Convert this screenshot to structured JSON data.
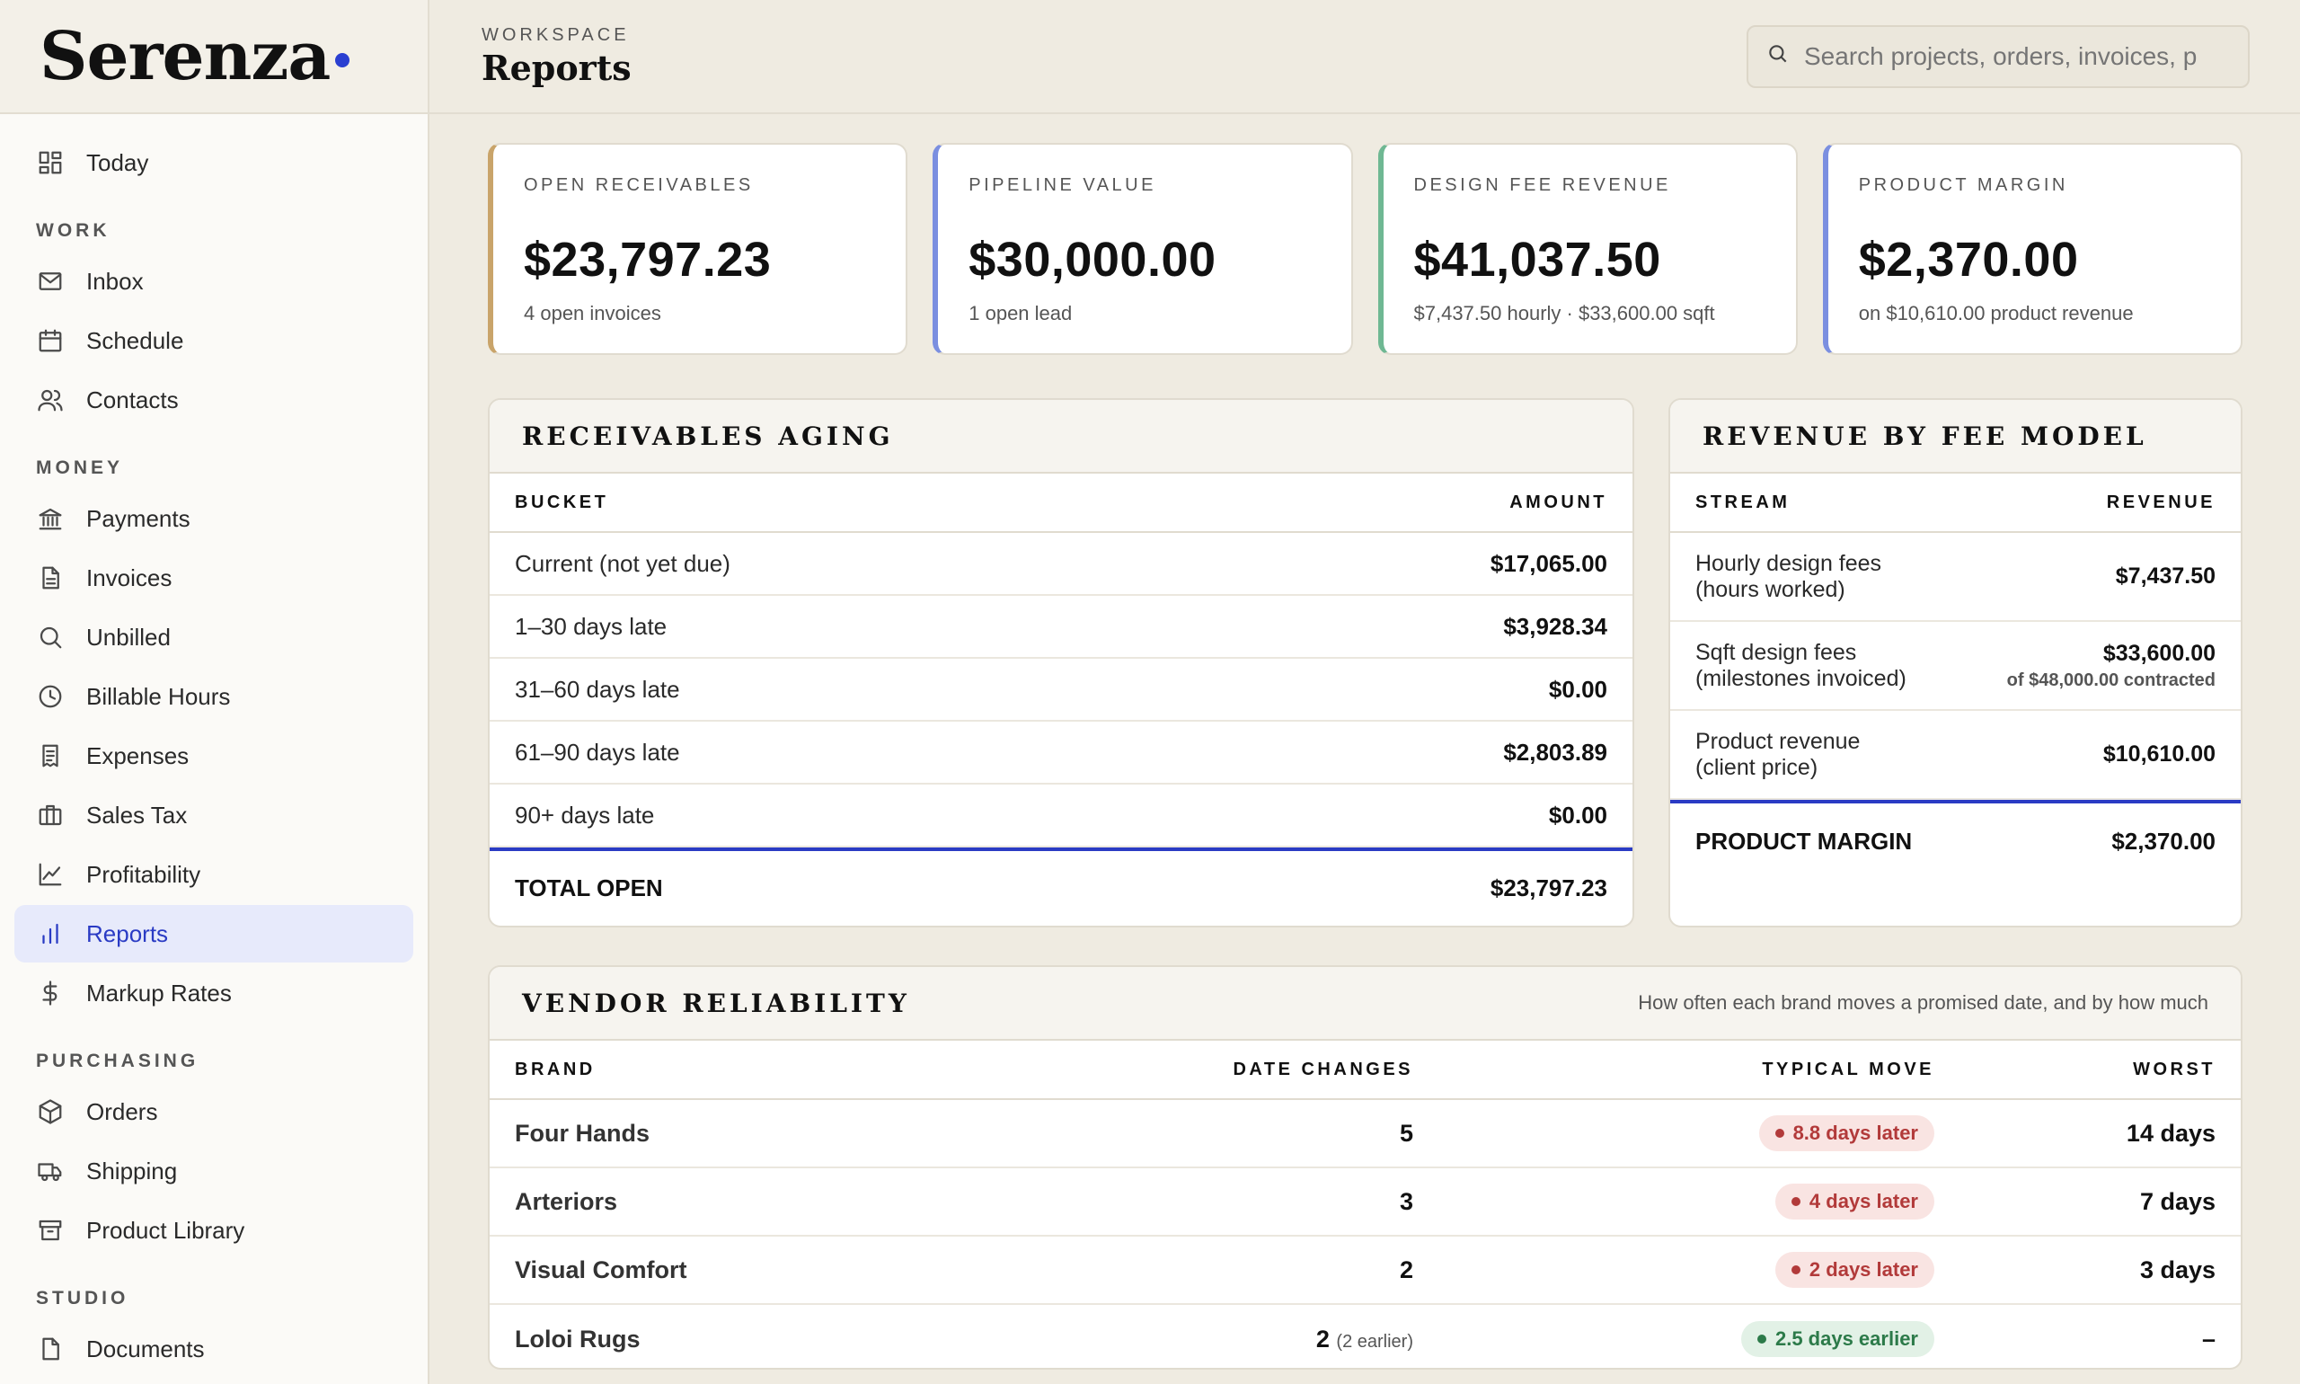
{
  "sidebar": {
    "brand": "Serenza",
    "top_item": {
      "label": "Today",
      "icon": "grid-icon"
    },
    "sections": [
      {
        "title": "WORK",
        "items": [
          {
            "label": "Inbox",
            "icon": "mail-icon"
          },
          {
            "label": "Schedule",
            "icon": "calendar-icon"
          },
          {
            "label": "Contacts",
            "icon": "users-icon"
          }
        ]
      },
      {
        "title": "MONEY",
        "items": [
          {
            "label": "Payments",
            "icon": "bank-icon"
          },
          {
            "label": "Invoices",
            "icon": "file-icon"
          },
          {
            "label": "Unbilled",
            "icon": "search-icon"
          },
          {
            "label": "Billable Hours",
            "icon": "clock-icon"
          },
          {
            "label": "Expenses",
            "icon": "receipt-icon"
          },
          {
            "label": "Sales Tax",
            "icon": "briefcase-icon"
          },
          {
            "label": "Profitability",
            "icon": "line-chart-icon"
          },
          {
            "label": "Reports",
            "icon": "bar-chart-icon",
            "active": true
          },
          {
            "label": "Markup Rates",
            "icon": "dollar-icon"
          }
        ]
      },
      {
        "title": "PURCHASING",
        "items": [
          {
            "label": "Orders",
            "icon": "box-icon"
          },
          {
            "label": "Shipping",
            "icon": "truck-icon"
          },
          {
            "label": "Product Library",
            "icon": "archive-icon"
          }
        ]
      },
      {
        "title": "STUDIO",
        "items": [
          {
            "label": "Documents",
            "icon": "document-icon"
          }
        ]
      }
    ]
  },
  "header": {
    "eyebrow": "WORKSPACE",
    "title": "Reports",
    "search_placeholder": "Search projects, orders, invoices, p"
  },
  "kpis": [
    {
      "label": "OPEN RECEIVABLES",
      "value": "$23,797.23",
      "sub": "4 open invoices",
      "accent": "#c9a46a"
    },
    {
      "label": "PIPELINE VALUE",
      "value": "$30,000.00",
      "sub": "1 open lead",
      "accent": "#7b8fe0"
    },
    {
      "label": "DESIGN FEE REVENUE",
      "value": "$41,037.50",
      "sub": "$7,437.50 hourly · $33,600.00 sqft",
      "accent": "#6fb893"
    },
    {
      "label": "PRODUCT MARGIN",
      "value": "$2,370.00",
      "sub": "on $10,610.00 product revenue",
      "accent": "#7b8fe0"
    }
  ],
  "aging": {
    "title": "RECEIVABLES AGING",
    "col_bucket": "BUCKET",
    "col_amount": "AMOUNT",
    "rows": [
      {
        "bucket": "Current (not yet due)",
        "amount": "$17,065.00"
      },
      {
        "bucket": "1–30 days late",
        "amount": "$3,928.34"
      },
      {
        "bucket": "31–60 days late",
        "amount": "$0.00"
      },
      {
        "bucket": "61–90 days late",
        "amount": "$2,803.89"
      },
      {
        "bucket": "90+ days late",
        "amount": "$0.00"
      }
    ],
    "total_label": "TOTAL OPEN",
    "total_amount": "$23,797.23"
  },
  "revenue": {
    "title": "REVENUE BY FEE MODEL",
    "col_stream": "STREAM",
    "col_revenue": "REVENUE",
    "rows": [
      {
        "line1": "Hourly design fees",
        "line2": "(hours worked)",
        "amount": "$7,437.50",
        "note": ""
      },
      {
        "line1": "Sqft design fees",
        "line2": "(milestones invoiced)",
        "amount": "$33,600.00",
        "note": "of $48,000.00 contracted"
      },
      {
        "line1": "Product revenue",
        "line2": "(client price)",
        "amount": "$10,610.00",
        "note": ""
      }
    ],
    "total_label": "PRODUCT MARGIN",
    "total_amount": "$2,370.00"
  },
  "vendors": {
    "title": "VENDOR RELIABILITY",
    "note": "How often each brand moves a promised date, and by how much",
    "cols": [
      "BRAND",
      "DATE CHANGES",
      "TYPICAL MOVE",
      "WORST"
    ],
    "rows": [
      {
        "brand": "Four Hands",
        "changes": "5",
        "changes_note": "",
        "move": "8.8 days later",
        "kind": "late",
        "worst": "14 days"
      },
      {
        "brand": "Arteriors",
        "changes": "3",
        "changes_note": "",
        "move": "4 days later",
        "kind": "late",
        "worst": "7 days"
      },
      {
        "brand": "Visual Comfort",
        "changes": "2",
        "changes_note": "",
        "move": "2 days later",
        "kind": "late",
        "worst": "3 days"
      },
      {
        "brand": "Loloi Rugs",
        "changes": "2",
        "changes_note": "(2 earlier)",
        "move": "2.5 days earlier",
        "kind": "early",
        "worst": "–"
      }
    ]
  }
}
